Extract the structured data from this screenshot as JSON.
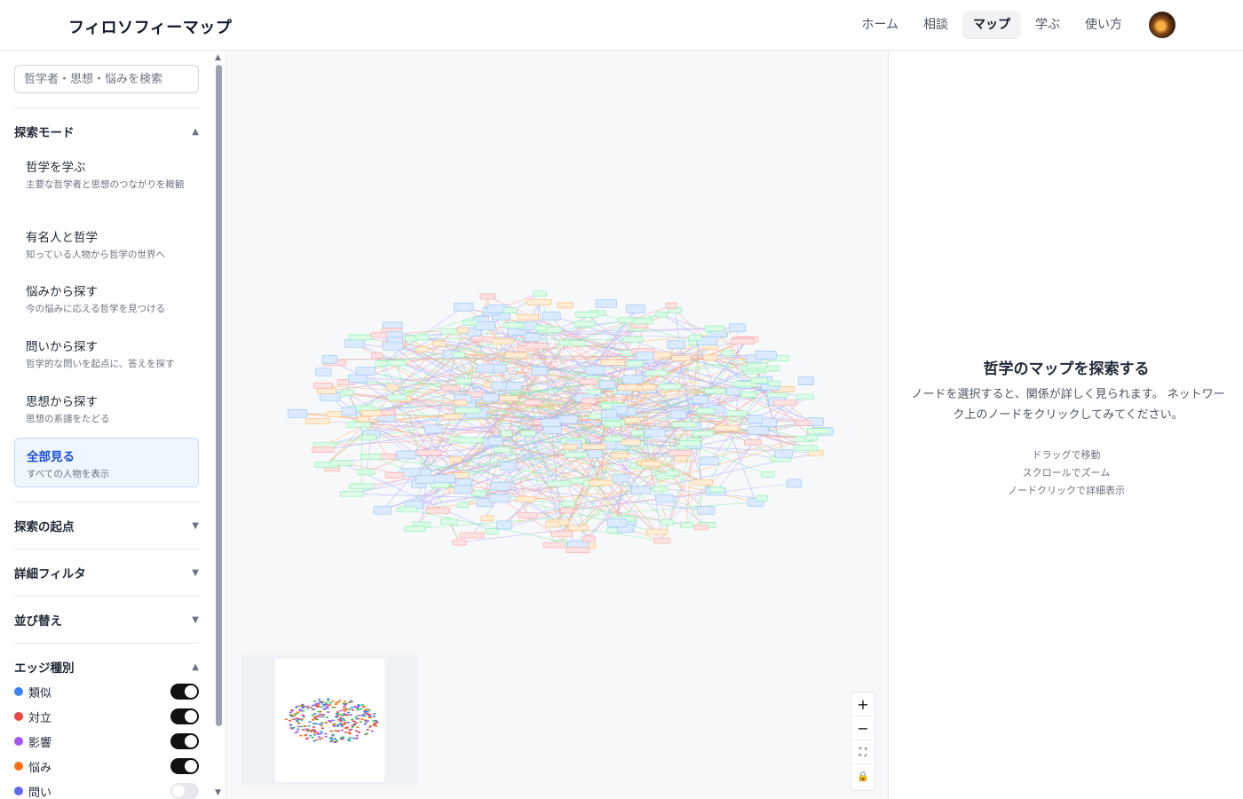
{
  "header": {
    "app_title": "フィロソフィーマップ",
    "nav": [
      {
        "label": "ホーム",
        "active": false
      },
      {
        "label": "相談",
        "active": false
      },
      {
        "label": "マップ",
        "active": true
      },
      {
        "label": "学ぶ",
        "active": false
      },
      {
        "label": "使い方",
        "active": false
      }
    ]
  },
  "sidebar": {
    "search_placeholder": "哲学者・思想・悩みを検索",
    "explore_mode": {
      "title": "探索モード",
      "expanded": true,
      "modes": [
        {
          "title": "哲学を学ぶ",
          "desc": "主要な哲学者と思想のつながりを概観",
          "active": false
        },
        {
          "title": "有名人と哲学",
          "desc": "知っている人物から哲学の世界へ",
          "active": false
        },
        {
          "title": "悩みから探す",
          "desc": "今の悩みに応える哲学を見つける",
          "active": false
        },
        {
          "title": "問いから探す",
          "desc": "哲学的な問いを起点に、答えを探す",
          "active": false
        },
        {
          "title": "思想から探す",
          "desc": "思想の系譜をたどる",
          "active": false
        },
        {
          "title": "全部見る",
          "desc": "すべての人物を表示",
          "active": true
        }
      ]
    },
    "sections": [
      {
        "title": "探索の起点",
        "expanded": false
      },
      {
        "title": "詳細フィルタ",
        "expanded": false
      },
      {
        "title": "並び替え",
        "expanded": false
      }
    ],
    "edge_types": {
      "title": "エッジ種別",
      "expanded": true,
      "items": [
        {
          "label": "類似",
          "color": "#3b82f6",
          "on": true
        },
        {
          "label": "対立",
          "color": "#ef4444",
          "on": true
        },
        {
          "label": "影響",
          "color": "#a855f7",
          "on": true
        },
        {
          "label": "悩み",
          "color": "#f97316",
          "on": true
        },
        {
          "label": "問い",
          "color": "#6366f1",
          "on": false
        }
      ]
    }
  },
  "graph": {
    "node_colors": {
      "philosopher": "#dbeafe",
      "concern": "#ffedd5",
      "question": "#dcfce7",
      "opposition": "#fee2e2"
    },
    "edge_colors": [
      "#a5b4fc",
      "#c4b5fd",
      "#fdba74",
      "#86efac",
      "#fca5a5"
    ]
  },
  "zoom_controls": [
    "+",
    "−",
    "⛶",
    "🔒"
  ],
  "panel": {
    "title": "哲学のマップを探索する",
    "text": "ノードを選択すると、関係が詳しく見られます。 ネットワーク上のノードをクリックしてみてください。",
    "hints": [
      "ドラッグで移動",
      "スクロールでズーム",
      "ノードクリックで詳細表示"
    ]
  }
}
